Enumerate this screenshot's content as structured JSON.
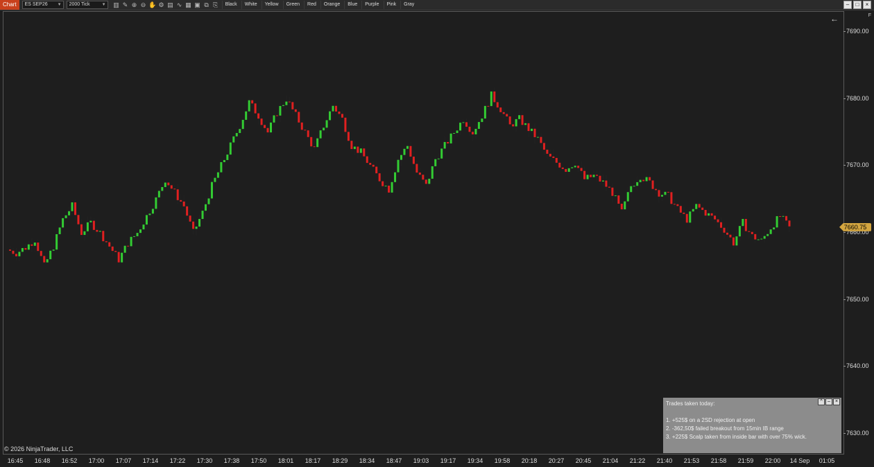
{
  "toolbar": {
    "tab_label": "Chart",
    "instrument": "ES SEP26",
    "interval": "2000 Tick",
    "tools": [
      "bar-chart-icon",
      "pencil-icon",
      "zoom-in-icon",
      "zoom-out-icon",
      "hand-icon",
      "properties-icon",
      "strategy-icon",
      "indicator-icon",
      "template-icon",
      "data-box-icon",
      "screenshot-icon",
      "copy-icon"
    ],
    "colors": [
      "Black",
      "White",
      "Yellow",
      "Green",
      "Red",
      "Orange",
      "Blue",
      "Purple",
      "Pink",
      "Gray"
    ]
  },
  "price_axis": {
    "ticks": [
      "7690.00",
      "7680.00",
      "7670.00",
      "7660.00",
      "7650.00",
      "7640.00",
      "7630.00"
    ],
    "last_price": "7660.75",
    "flag": "F"
  },
  "time_axis": {
    "labels": [
      "16:45",
      "16:48",
      "16:52",
      "17:00",
      "17:07",
      "17:14",
      "17:22",
      "17:30",
      "17:38",
      "17:50",
      "18:01",
      "18:17",
      "18:29",
      "18:34",
      "18:47",
      "19:03",
      "19:17",
      "19:34",
      "19:58",
      "20:18",
      "20:27",
      "20:45",
      "21:04",
      "21:22",
      "21:40",
      "21:53",
      "21:58",
      "21:59",
      "22:00",
      "14 Sep",
      "01:05"
    ]
  },
  "copyright": "© 2026 NinjaTrader, LLC",
  "notes": {
    "title": "Trades taken today:",
    "lines": [
      "1. +525$ on a 2SD rejection at open",
      "2. -362,50$ failed breakout from 15min IB range",
      "3. +225$ Scalp taken from inside bar with over 75% wick."
    ]
  },
  "chart_data": {
    "type": "candlestick",
    "instrument": "ES SEP26",
    "interval": "2000 Tick",
    "up_color": "#33cc33",
    "down_color": "#e02020",
    "ylim": [
      7627,
      7693
    ],
    "close_series": [
      7657.5,
      7657.0,
      7657.8,
      7659.0,
      7655.0,
      7658.0,
      7662.0,
      7664.0,
      7660.0,
      7661.5,
      7660.0,
      7658.0,
      7656.0,
      7658.5,
      7660.0,
      7662.5,
      7665.0,
      7668.0,
      7666.0,
      7664.0,
      7660.0,
      7663.0,
      7667.0,
      7670.0,
      7673.0,
      7676.0,
      7679.5,
      7677.5,
      7675.0,
      7678.0,
      7680.0,
      7677.5,
      7675.0,
      7672.5,
      7676.0,
      7679.0,
      7677.0,
      7673.0,
      7672.0,
      7670.0,
      7668.0,
      7666.5,
      7671.0,
      7673.0,
      7669.0,
      7667.0,
      7671.0,
      7673.0,
      7675.0,
      7677.0,
      7675.0,
      7677.5,
      7680.5,
      7678.5,
      7676.0,
      7677.0,
      7675.5,
      7674.0,
      7671.5,
      7670.5,
      7669.5,
      7670.5,
      7668.0,
      7668.5,
      7667.5,
      7666.0,
      7663.0,
      7667.0,
      7668.5,
      7667.5,
      7666.0,
      7665.5,
      7663.5,
      7662.0,
      7664.0,
      7663.0,
      7662.0,
      7660.5,
      7658.5,
      7661.5,
      7659.5,
      7658.8,
      7660.8,
      7662.5,
      7660.75
    ]
  }
}
